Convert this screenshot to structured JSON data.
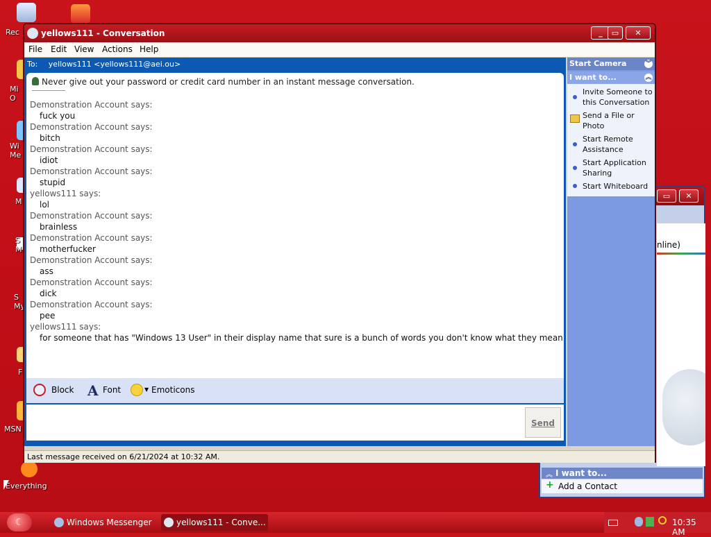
{
  "desktop": {
    "icons": [
      {
        "label": "Rec",
        "icon": "recycle-bin-icon"
      },
      {
        "label": "",
        "icon": "messenger-shortcut-icon"
      },
      {
        "label": "Mi\nO",
        "icon": "shortcut-icon"
      },
      {
        "label": "Wi\nMe",
        "icon": "shortcut-icon"
      },
      {
        "label": "M",
        "icon": "shortcut-icon"
      },
      {
        "label": "S\nM",
        "icon": "shortcut-icon"
      },
      {
        "label": "S\nMy",
        "icon": "shortcut-icon"
      },
      {
        "label": "F",
        "icon": "shortcut-icon"
      },
      {
        "label": "MSN",
        "icon": "msn-icon"
      },
      {
        "label": "Everything",
        "icon": "everything-icon"
      }
    ]
  },
  "conversation": {
    "title": "yellows111 - Conversation",
    "menu": [
      "File",
      "Edit",
      "View",
      "Actions",
      "Help"
    ],
    "to_label": "To:",
    "to_value": "yellows111 <yellows111@aei.ou>",
    "warning": "Never give out your password or credit card number in an instant message conversation.",
    "messages": [
      {
        "sender": "Demonstration Account says:",
        "text": "fuck you"
      },
      {
        "sender": "Demonstration Account says:",
        "text": "bitch"
      },
      {
        "sender": "Demonstration Account says:",
        "text": "idiot"
      },
      {
        "sender": "Demonstration Account says:",
        "text": "stupid"
      },
      {
        "sender": "yellows111 says:",
        "text": "lol"
      },
      {
        "sender": "Demonstration Account says:",
        "text": "brainless"
      },
      {
        "sender": "Demonstration Account says:",
        "text": "motherfucker"
      },
      {
        "sender": "Demonstration Account says:",
        "text": "ass"
      },
      {
        "sender": "Demonstration Account says:",
        "text": "dick"
      },
      {
        "sender": "Demonstration Account says:",
        "text": "pee"
      },
      {
        "sender": "yellows111 says:",
        "text": "for someone that has \"Windows 13 User\" in their display name that sure is a bunch of words you don't know what they mean"
      }
    ],
    "format_bar": {
      "block": "Block",
      "font": "Font",
      "emoticons": "Emoticons"
    },
    "input_value": "",
    "send": "Send",
    "status": "Last message received on 6/21/2024 at 10:32 AM.",
    "side": {
      "start_camera": "Start Camera",
      "i_want_to": "I want to...",
      "tasks": [
        "Invite Someone to this Conversation",
        "Send a File or Photo",
        "Start Remote Assistance",
        "Start Application Sharing",
        "Start Whiteboard"
      ]
    }
  },
  "back_window": {
    "status_fragment": "nline)",
    "i_want_to": "I want to...",
    "add_contact": "Add a Contact"
  },
  "taskbar": {
    "buttons": [
      "Windows Messenger",
      "yellows111 - Conve..."
    ],
    "clock": "10:35 AM"
  },
  "colors": {
    "desktop": "#c8131b",
    "titlebar": "#b8151c",
    "conversation_frame": "#0b59b3",
    "side_pane": "#7c9ae2"
  }
}
